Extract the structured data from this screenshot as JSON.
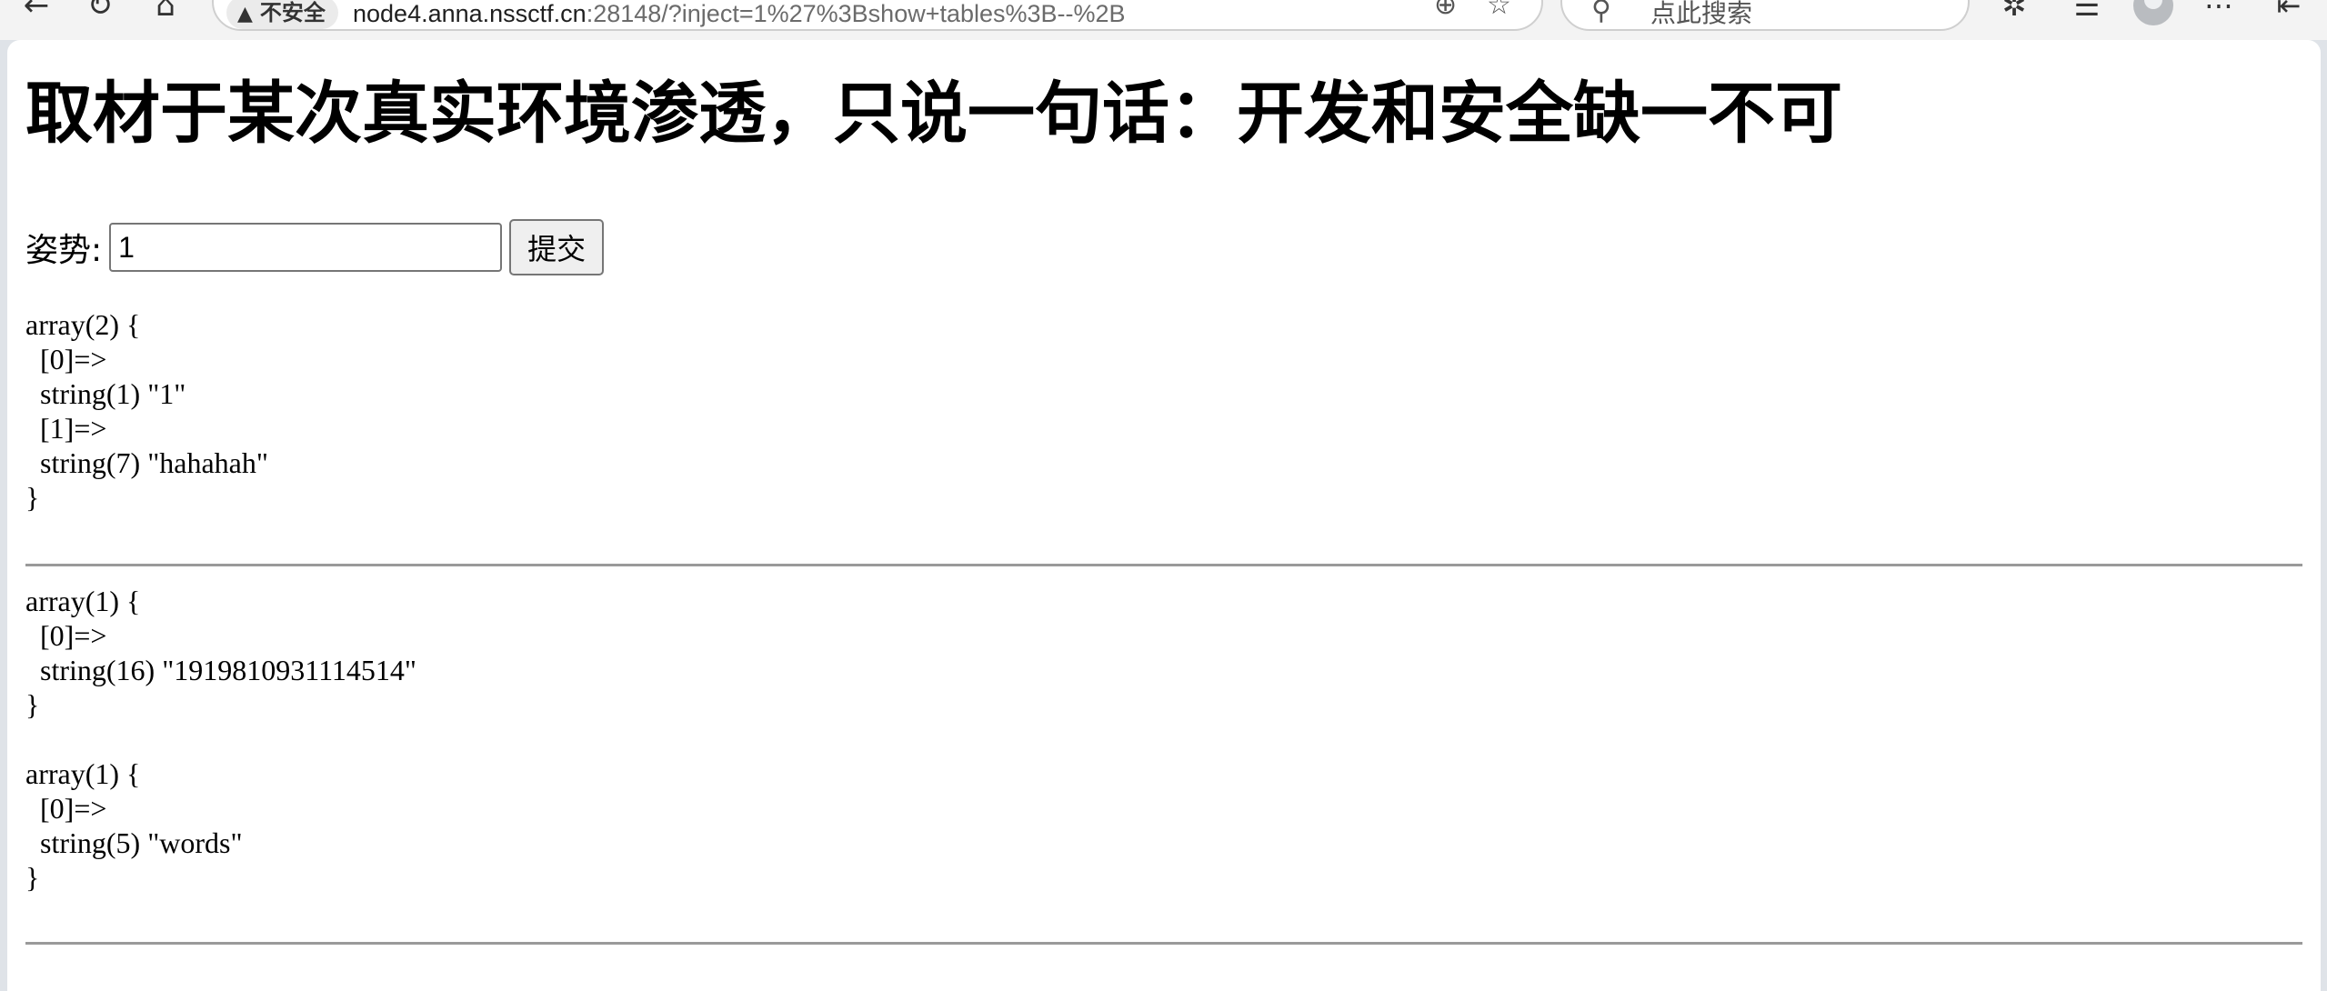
{
  "browser": {
    "security_label": "不安全",
    "url_host": "node4.anna.nssctf.cn",
    "url_rest": ":28148/?inject=1%27%3Bshow+tables%3B--%2B",
    "search_placeholder": "点此搜索"
  },
  "page": {
    "title": "取材于某次真实环境渗透，只说一句话：开发和安全缺一不可",
    "form": {
      "label": "姿势:",
      "input_value": "1",
      "submit_label": "提交"
    },
    "dumps": [
      "array(2) {\n  [0]=>\n  string(1) \"1\"\n  [1]=>\n  string(7) \"hahahah\"\n}",
      "array(1) {\n  [0]=>\n  string(16) \"1919810931114514\"\n}",
      "array(1) {\n  [0]=>\n  string(5) \"words\"\n}"
    ]
  }
}
